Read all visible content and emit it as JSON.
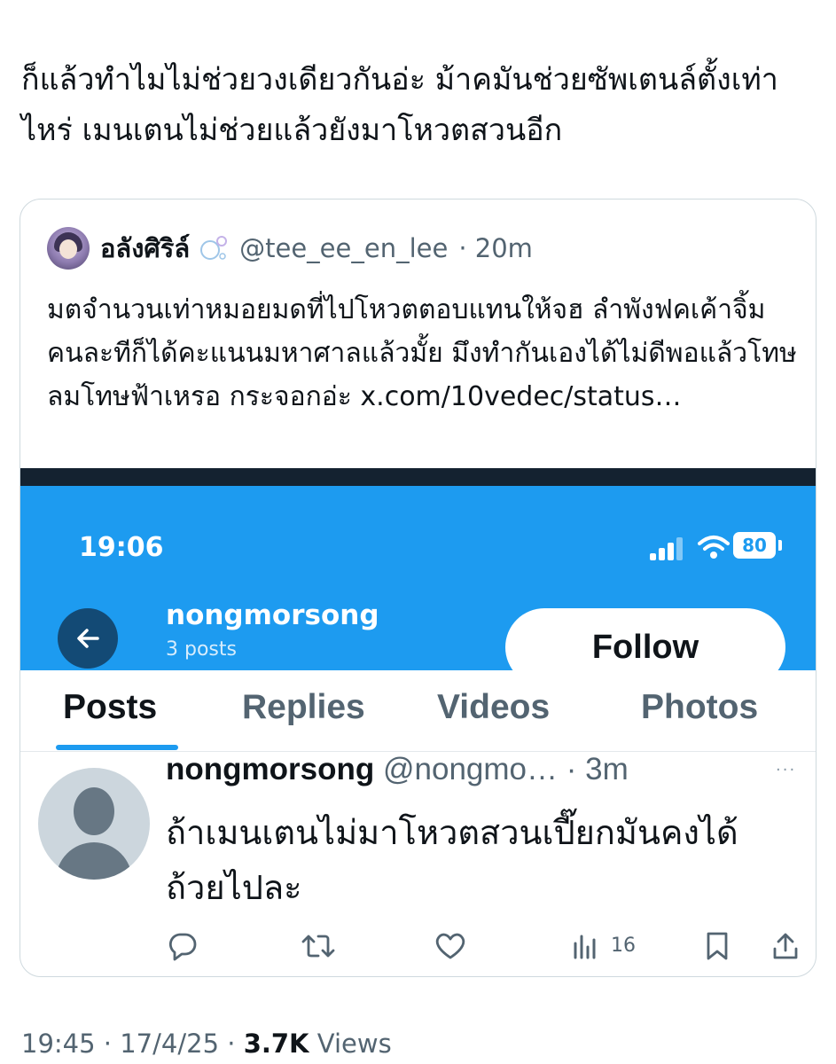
{
  "tweet": {
    "text": "ก็แล้วทำไมไม่ช่วยวงเดียวกันอ่ะ ม้าคมันช่วยซัพเตนล์ตั้งเท่าไหร่ เมนเตนไม่ช่วยแล้วยังมาโหวตสวนอีก"
  },
  "quote": {
    "display_name": "อลังศิริล์",
    "handle": "@tee_ee_en_lee",
    "time": "· 20m",
    "text": "มตจำนวนเท่าหมอยมดที่ไปโหวตตอบแทนให้จฮ ลำพังฟคเค้าจิ้มคนละทีก็ได้คะแนนมหาศาลแล้วมั้ย มึงทำกันเองได้ไม่ดีพอแล้วโทษลมโทษฟ้าเหรอ กระจอกอ่ะ x.com/10vedec/status…"
  },
  "embedded_screenshot": {
    "status_time": "19:06",
    "battery": "80",
    "profile_name": "nongmorsong",
    "profile_posts": "3 posts",
    "follow_label": "Follow",
    "tabs": [
      "Posts",
      "Replies",
      "Videos",
      "Photos"
    ],
    "active_tab": "Posts",
    "post": {
      "name": "nongmorsong",
      "handle": "@nongmo…",
      "time": "· 3m",
      "more": "···",
      "text": "ถ้าเมนเตนไม่มาโหวตสวนเปี๊ยกมันคงได้ถ้วยไปละ",
      "views": "16"
    }
  },
  "footer": {
    "time": "19:45",
    "sep1": " · ",
    "date": "17/4/25",
    "sep2": " · ",
    "views_count": "3.7K",
    "views_label": " Views"
  },
  "colors": {
    "accent": "#1d9bf0",
    "header_dark": "#142230",
    "secondary_text": "#536471"
  }
}
